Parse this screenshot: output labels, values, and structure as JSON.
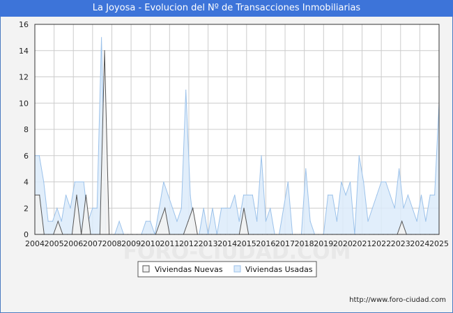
{
  "header": {
    "title": "La Joyosa - Evolucion del Nº de Transacciones Inmobiliarias"
  },
  "footer": {
    "url": "http://www.foro-ciudad.com"
  },
  "watermark": "FORO-CIUDAD.COM",
  "colors": {
    "title_bar": "#3d74d9",
    "nuevas_line": "#555555",
    "nuevas_fill": "#f2f2f2",
    "usadas_line": "#9cc2ea",
    "usadas_fill": "#dcebfa",
    "grid": "#cccccc"
  },
  "chart_data": {
    "type": "area",
    "title": "La Joyosa - Evolucion del Nº de Transacciones Inmobiliarias",
    "xlabel": "",
    "ylabel": "",
    "ylim": [
      0,
      16
    ],
    "yticks": [
      0,
      2,
      4,
      6,
      8,
      10,
      12,
      14,
      16
    ],
    "xlim": [
      2004,
      2025
    ],
    "x_tick_labels": [
      "2004",
      "2005",
      "2006",
      "2007",
      "2008",
      "2009",
      "2010",
      "2011",
      "2012",
      "2013",
      "2014",
      "2015",
      "2016",
      "2017",
      "2018",
      "2019",
      "2020",
      "2021",
      "2022",
      "2023",
      "2024",
      "2025"
    ],
    "grid": true,
    "legend_position": "bottom",
    "x_note": "quarterly values, 2004 Q1 to 2025 Q1",
    "series": [
      {
        "name": "Viviendas Nuevas",
        "values": [
          3,
          3,
          0,
          0,
          0,
          1,
          0,
          0,
          0,
          3,
          0,
          3,
          0,
          0,
          0,
          14,
          0,
          0,
          0,
          0,
          0,
          0,
          0,
          0,
          0,
          0,
          0,
          1,
          2,
          0,
          0,
          0,
          0,
          1,
          2,
          0,
          0,
          0,
          0,
          0,
          0,
          0,
          0,
          0,
          0,
          2,
          0,
          0,
          0,
          0,
          0,
          0,
          0,
          0,
          0,
          0,
          0,
          0,
          0,
          0,
          0,
          0,
          0,
          0,
          0,
          0,
          0,
          0,
          0,
          0,
          0,
          0,
          0,
          0,
          0,
          0,
          0,
          0,
          0,
          1,
          0,
          0,
          0,
          0,
          0,
          0,
          0,
          0
        ]
      },
      {
        "name": "Viviendas Usadas",
        "values": [
          6,
          6,
          4,
          1,
          1,
          2,
          1,
          3,
          2,
          4,
          4,
          4,
          1,
          2,
          2,
          15,
          0,
          0,
          0,
          1,
          0,
          0,
          0,
          0,
          0,
          1,
          1,
          0,
          2,
          4,
          3,
          2,
          1,
          2,
          11,
          3,
          0,
          0,
          2,
          0,
          2,
          0,
          2,
          2,
          2,
          3,
          1,
          3,
          3,
          3,
          1,
          6,
          1,
          2,
          0,
          0,
          2,
          4,
          0,
          0,
          0,
          5,
          1,
          0,
          0,
          0,
          3,
          3,
          1,
          4,
          3,
          4,
          0,
          6,
          4,
          1,
          2,
          3,
          4,
          4,
          3,
          2,
          5,
          2,
          3,
          2,
          1,
          3,
          1,
          3,
          3,
          10
        ]
      }
    ]
  }
}
